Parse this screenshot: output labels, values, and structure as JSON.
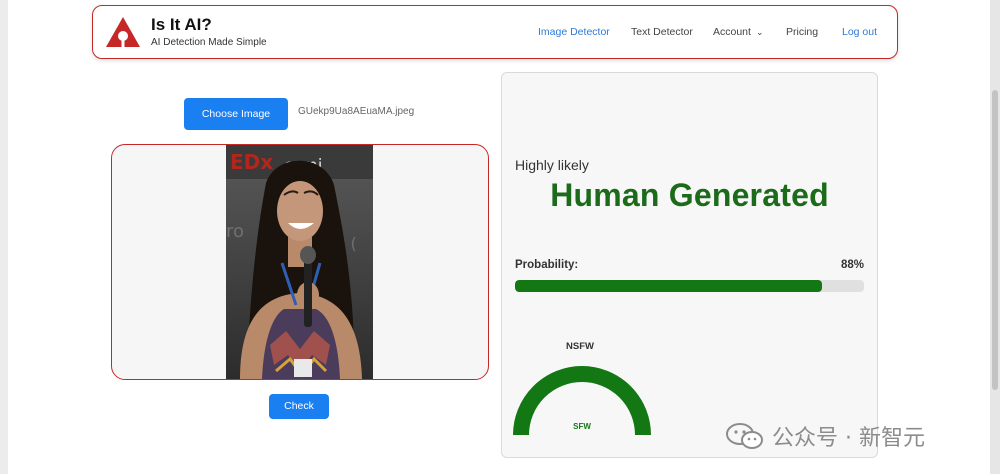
{
  "brand": {
    "title": "Is It AI?",
    "subtitle": "AI Detection Made Simple"
  },
  "nav": {
    "image_detector": "Image Detector",
    "text_detector": "Text Detector",
    "account": "Account",
    "pricing": "Pricing",
    "logout": "Log out"
  },
  "upload": {
    "choose_label": "Choose Image",
    "filename": "GUekp9Ua8AEuaMA.jpeg"
  },
  "check_label": "Check",
  "result": {
    "likelihood": "Highly likely",
    "verdict": "Human Generated",
    "probability_label": "Probability:",
    "probability_text": "88%",
    "probability_value": 0.88,
    "nsfw_label": "NSFW",
    "sfw_label": "SFW"
  },
  "watermark": "公众号 · 新智元",
  "colors": {
    "accent_red": "#c62828",
    "button_blue": "#1a7ff0",
    "verdict_green": "#1b6b1b",
    "bar_green": "#137813"
  }
}
